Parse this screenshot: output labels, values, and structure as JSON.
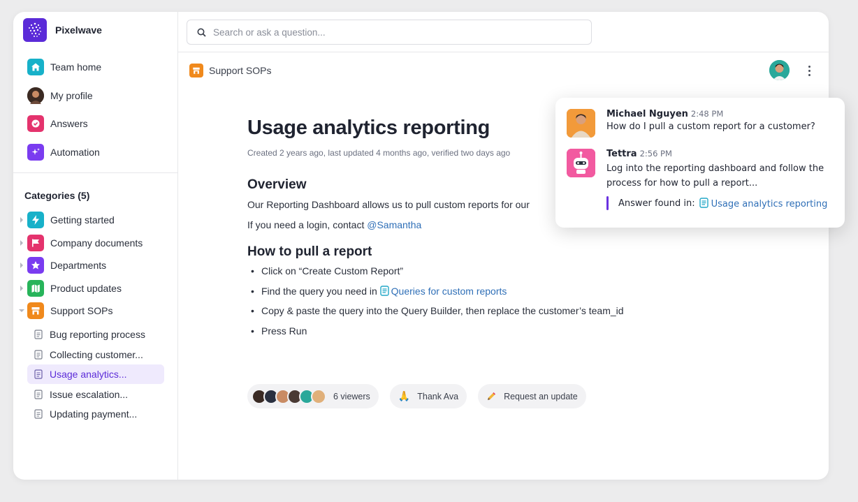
{
  "brand": {
    "name": "Pixelwave"
  },
  "nav": [
    {
      "label": "Team home",
      "icon": "home-icon",
      "color": "#17b1c9"
    },
    {
      "label": "My profile",
      "icon": "profile-avatar",
      "color": "#3b2a22"
    },
    {
      "label": "Answers",
      "icon": "answers-icon",
      "color": "#e4336d"
    },
    {
      "label": "Automation",
      "icon": "sparkle-icon",
      "color": "#7a3cf0"
    }
  ],
  "categories": {
    "title": "Categories (5)",
    "items": [
      {
        "label": "Getting started",
        "icon": "bolt-icon",
        "color": "#17b1c9"
      },
      {
        "label": "Company documents",
        "icon": "flag-icon",
        "color": "#e4336d"
      },
      {
        "label": "Departments",
        "icon": "star-icon",
        "color": "#7a3cf0"
      },
      {
        "label": "Product updates",
        "icon": "map-icon",
        "color": "#27b45a"
      },
      {
        "label": "Support SOPs",
        "icon": "store-icon",
        "color": "#f0891c"
      }
    ],
    "docs": [
      {
        "label": "Bug reporting process"
      },
      {
        "label": "Collecting customer..."
      },
      {
        "label": "Usage analytics..."
      },
      {
        "label": "Issue escalation..."
      },
      {
        "label": "Updating payment..."
      }
    ]
  },
  "search": {
    "placeholder": "Search or ask a question..."
  },
  "breadcrumb": {
    "label": "Support SOPs"
  },
  "article": {
    "title": "Usage analytics reporting",
    "meta": "Created 2 years ago, last updated 4 months ago, verified two days ago",
    "overview_heading": "Overview",
    "overview_text": "Our Reporting Dashboard allows us to pull custom reports for our",
    "login_text": "If you need a login, contact ",
    "login_mention": "@Samantha",
    "howto_heading": "How to pull a report",
    "step1": "Click on “Create Custom Report”",
    "step2_prefix": "Find the query you need in ",
    "step2_link": "Queries for custom reports",
    "step3": "Copy & paste the query into the Query Builder, then replace the customer’s team_id",
    "step4": "Press Run"
  },
  "footer": {
    "viewers": "6 viewers",
    "thank": "Thank Ava",
    "request": "Request an update"
  },
  "chat": {
    "msg1": {
      "name": "Michael Nguyen",
      "time": "2:48 PM",
      "text": "How do I pull a custom report for a customer?"
    },
    "msg2": {
      "name": "Tettra",
      "time": "2:56 PM",
      "text": "Log into the reporting dashboard and follow the process for how to pull a report...",
      "found_label": "Answer found in:",
      "found_link": "Usage analytics reporting"
    }
  },
  "colors": {
    "accent": "#5b2bd8",
    "link": "#2f6fb7",
    "active_bg": "#efeafd"
  }
}
